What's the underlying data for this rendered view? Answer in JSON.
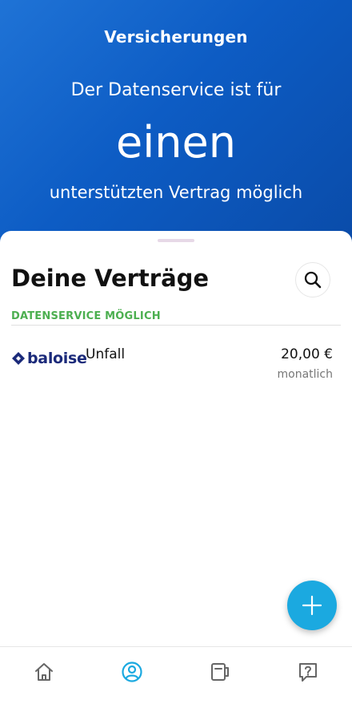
{
  "hero": {
    "title": "Versicherungen",
    "line1": "Der Datenservice ist für",
    "big": "einen",
    "line2": "unterstützten Vertrag möglich"
  },
  "contracts": {
    "title": "Deine Verträge",
    "section_label": "DATENSERVICE MÖGLICH",
    "items": [
      {
        "brand": "baloise",
        "name": "Unfall",
        "amount": "20,00 €",
        "period": "monatlich"
      }
    ]
  },
  "icons": {
    "search": "search-icon",
    "add": "plus-icon",
    "nav_home": "home-icon",
    "nav_profile": "profile-icon",
    "nav_contracts": "wallet-icon",
    "nav_help": "help-icon"
  },
  "colors": {
    "hero_blue": "#0d5cc4",
    "accent": "#1ba9e0",
    "section_green": "#4caf50",
    "brand_navy": "#1b2a7a"
  }
}
